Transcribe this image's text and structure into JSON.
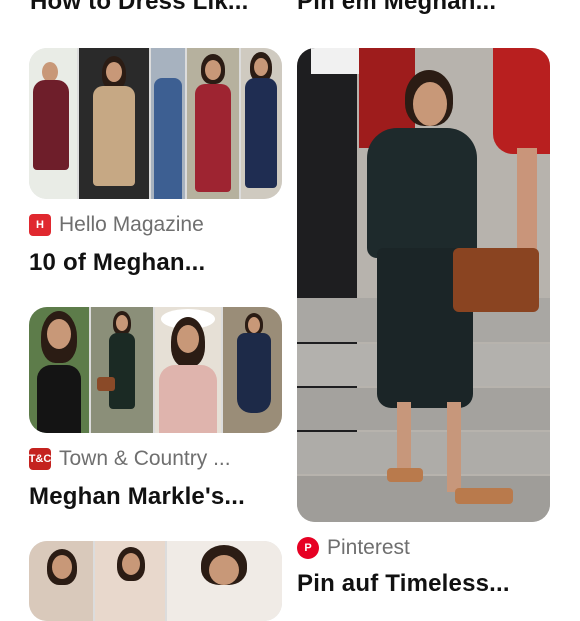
{
  "top_titles": {
    "left": "How to Dress Lik...",
    "right": "Pin em Meghan..."
  },
  "pins": [
    {
      "source_name": "Hello Magazine",
      "source_icon": "hello-magazine-icon",
      "source_color": "#e0282f",
      "source_glyph": "H",
      "title": "10 of Meghan..."
    },
    {
      "source_name": "Town & Country ...",
      "source_icon": "town-and-country-icon",
      "source_color": "#c4221f",
      "source_glyph": "T&C",
      "title": "Meghan Markle's..."
    },
    {
      "source_name": "Pinterest",
      "source_icon": "pinterest-icon",
      "source_color": "#e60023",
      "source_glyph": "P",
      "title": "Pin auf Timeless..."
    }
  ]
}
